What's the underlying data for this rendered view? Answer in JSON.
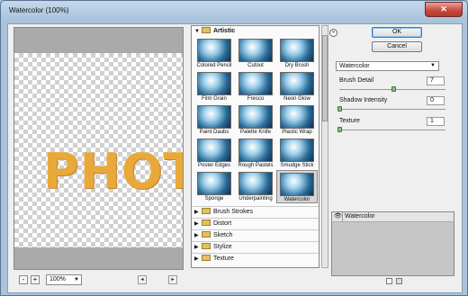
{
  "window": {
    "title": "Watercolor (100%)",
    "close_glyph": "✕"
  },
  "preview": {
    "text": "PHOTO",
    "zoom": "100%",
    "zoom_out": "-",
    "zoom_in": "+"
  },
  "browser": {
    "open_category": "Artistic",
    "thumbnails": [
      {
        "label": "Colored Pencil"
      },
      {
        "label": "Cutout"
      },
      {
        "label": "Dry Brush"
      },
      {
        "label": "Film Grain"
      },
      {
        "label": "Fresco"
      },
      {
        "label": "Neon Glow"
      },
      {
        "label": "Paint Daubs"
      },
      {
        "label": "Palette Knife"
      },
      {
        "label": "Plastic Wrap"
      },
      {
        "label": "Poster Edges"
      },
      {
        "label": "Rough Pastels"
      },
      {
        "label": "Smudge Stick"
      },
      {
        "label": "Sponge"
      },
      {
        "label": "Underpainting"
      },
      {
        "label": "Watercolor"
      }
    ],
    "selected": "Watercolor",
    "closed_categories": [
      "Brush Strokes",
      "Distort",
      "Sketch",
      "Stylize",
      "Texture"
    ]
  },
  "buttons": {
    "ok": "OK",
    "cancel": "Cancel",
    "collapse_glyph": "«"
  },
  "filter": {
    "selected": "Watercolor",
    "params": [
      {
        "label": "Brush Detail",
        "value": "7",
        "level": 0.5
      },
      {
        "label": "Shadow Intensity",
        "value": "0",
        "level": 0.0
      },
      {
        "label": "Texture",
        "value": "1",
        "level": 0.0
      }
    ]
  },
  "layers": [
    {
      "name": "Watercolor"
    }
  ],
  "icons": {
    "eye": "eye-icon",
    "new_layer": "new-layer-icon",
    "delete_layer": "trash-icon"
  }
}
